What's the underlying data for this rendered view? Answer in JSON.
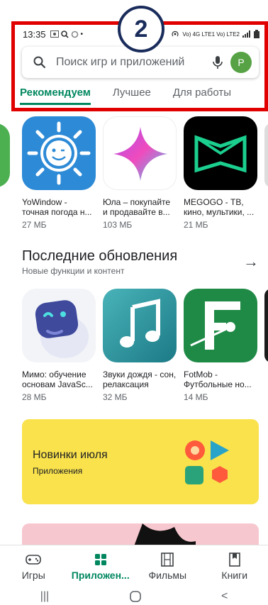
{
  "status_bar": {
    "time": "13:35",
    "right_text": "Vo) 4G LTE1 Vo) LTE2"
  },
  "annotation": {
    "number": "2"
  },
  "search": {
    "placeholder": "Поиск игр и приложений",
    "avatar_letter": "P"
  },
  "tabs": [
    "Рекомендуем",
    "Лучшее",
    "Для работы"
  ],
  "row1": [
    {
      "name": "YoWindow - точная погода н...",
      "size": "27 МБ"
    },
    {
      "name": "Юла – покупайте и продавайте в...",
      "size": "103 МБ"
    },
    {
      "name": "MEGOGO - ТВ, кино, мультики, ...",
      "size": "21 МБ"
    }
  ],
  "section": {
    "title": "Последние обновления",
    "subtitle": "Новые функции и контент"
  },
  "row2": [
    {
      "name": "Мимо: обучение основам JavaSc...",
      "size": "28 МБ"
    },
    {
      "name": "Звуки дождя - сон, релаксация",
      "size": "32 МБ"
    },
    {
      "name": "FotMob - Футбольные но...",
      "size": "14 МБ"
    }
  ],
  "promo": {
    "title": "Новинки июля",
    "subtitle": "Приложения"
  },
  "bottom_nav": [
    {
      "label": "Игры",
      "icon": "gamepad-icon"
    },
    {
      "label": "Приложен...",
      "icon": "apps-icon"
    },
    {
      "label": "Фильмы",
      "icon": "film-icon"
    },
    {
      "label": "Книги",
      "icon": "book-icon"
    }
  ],
  "colors": {
    "accent": "#01875f",
    "annotation_red": "#e00000",
    "annotation_navy": "#1a2c5b"
  }
}
